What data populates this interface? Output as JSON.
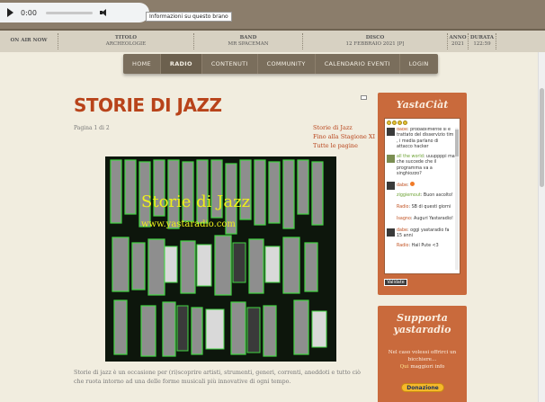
{
  "player": {
    "time": "0:00",
    "tooltip": "Informazioni su questo brano"
  },
  "infobar": {
    "on_air": "ON AIR NOW",
    "title_label": "TITOLO",
    "title_value": "ARCHEOLOGIE",
    "band_label": "BAND",
    "band_value": "MR SPACEMAN",
    "disco_label": "DISCO",
    "disco_value": "12 FEBBRAIO 2021 [P]",
    "anno_label": "ANNO",
    "anno_value": "2021",
    "durata_label": "DURATA",
    "durata_value": "122:59"
  },
  "nav": [
    "HOME",
    "RADIO",
    "CONTENUTI",
    "COMMUNITY",
    "CALENDARIO EVENTI",
    "LOGIN"
  ],
  "nav_active": "RADIO",
  "article": {
    "title": "STORIE DI JAZZ",
    "page_info": "Pagina 1 di 2",
    "toc": [
      "Storie di Jazz",
      "Fino alla Stagione XI",
      "Tutte le pagine"
    ],
    "image_title": "Storie di Jazz",
    "image_url": "www.yastaradio.com",
    "body": "Storie di jazz è un occasione per (ri)scoprire artisti, strumenti, generi, correnti, aneddoti e tutto ciò che ruota intorno ad una delle forme musicali più innovative di ogni tempo."
  },
  "chat": {
    "title": "YastaCiàt",
    "messages": [
      {
        "user": "dabe",
        "text": "probabilmente si è trattato del disservizio tim , i media parlano di attacco hacker"
      },
      {
        "user": "all the world",
        "text": "uuuppppi ma che succede che il programma va a singhiozzo?"
      },
      {
        "user": "dabe",
        "text": ""
      },
      {
        "user": "ziggiemout",
        "text": "Buon ascolto!"
      },
      {
        "user": "Radio",
        "text": "SB di questi giorni"
      },
      {
        "user": "Isagno",
        "text": "Auguri Yastaradio!"
      },
      {
        "user": "dabe",
        "text": "oggi yastaradio fa 15 anni"
      },
      {
        "user": "Radio",
        "text": "Hail Pute <3"
      }
    ],
    "validate": "Validate"
  },
  "support": {
    "title_line1": "Supporta",
    "title_line2": "yastaradio",
    "text_line1": "Nel caso volessi offrirci un",
    "text_line2": "bicchiere...",
    "link_qui": "Qui",
    "link_rest": "maggiori info",
    "donate": "Donazione"
  },
  "colors": {
    "accent": "#b8431a",
    "sidebar": "#c96a3c",
    "nav": "#7a6e5c",
    "image_text": "#eff01a"
  }
}
